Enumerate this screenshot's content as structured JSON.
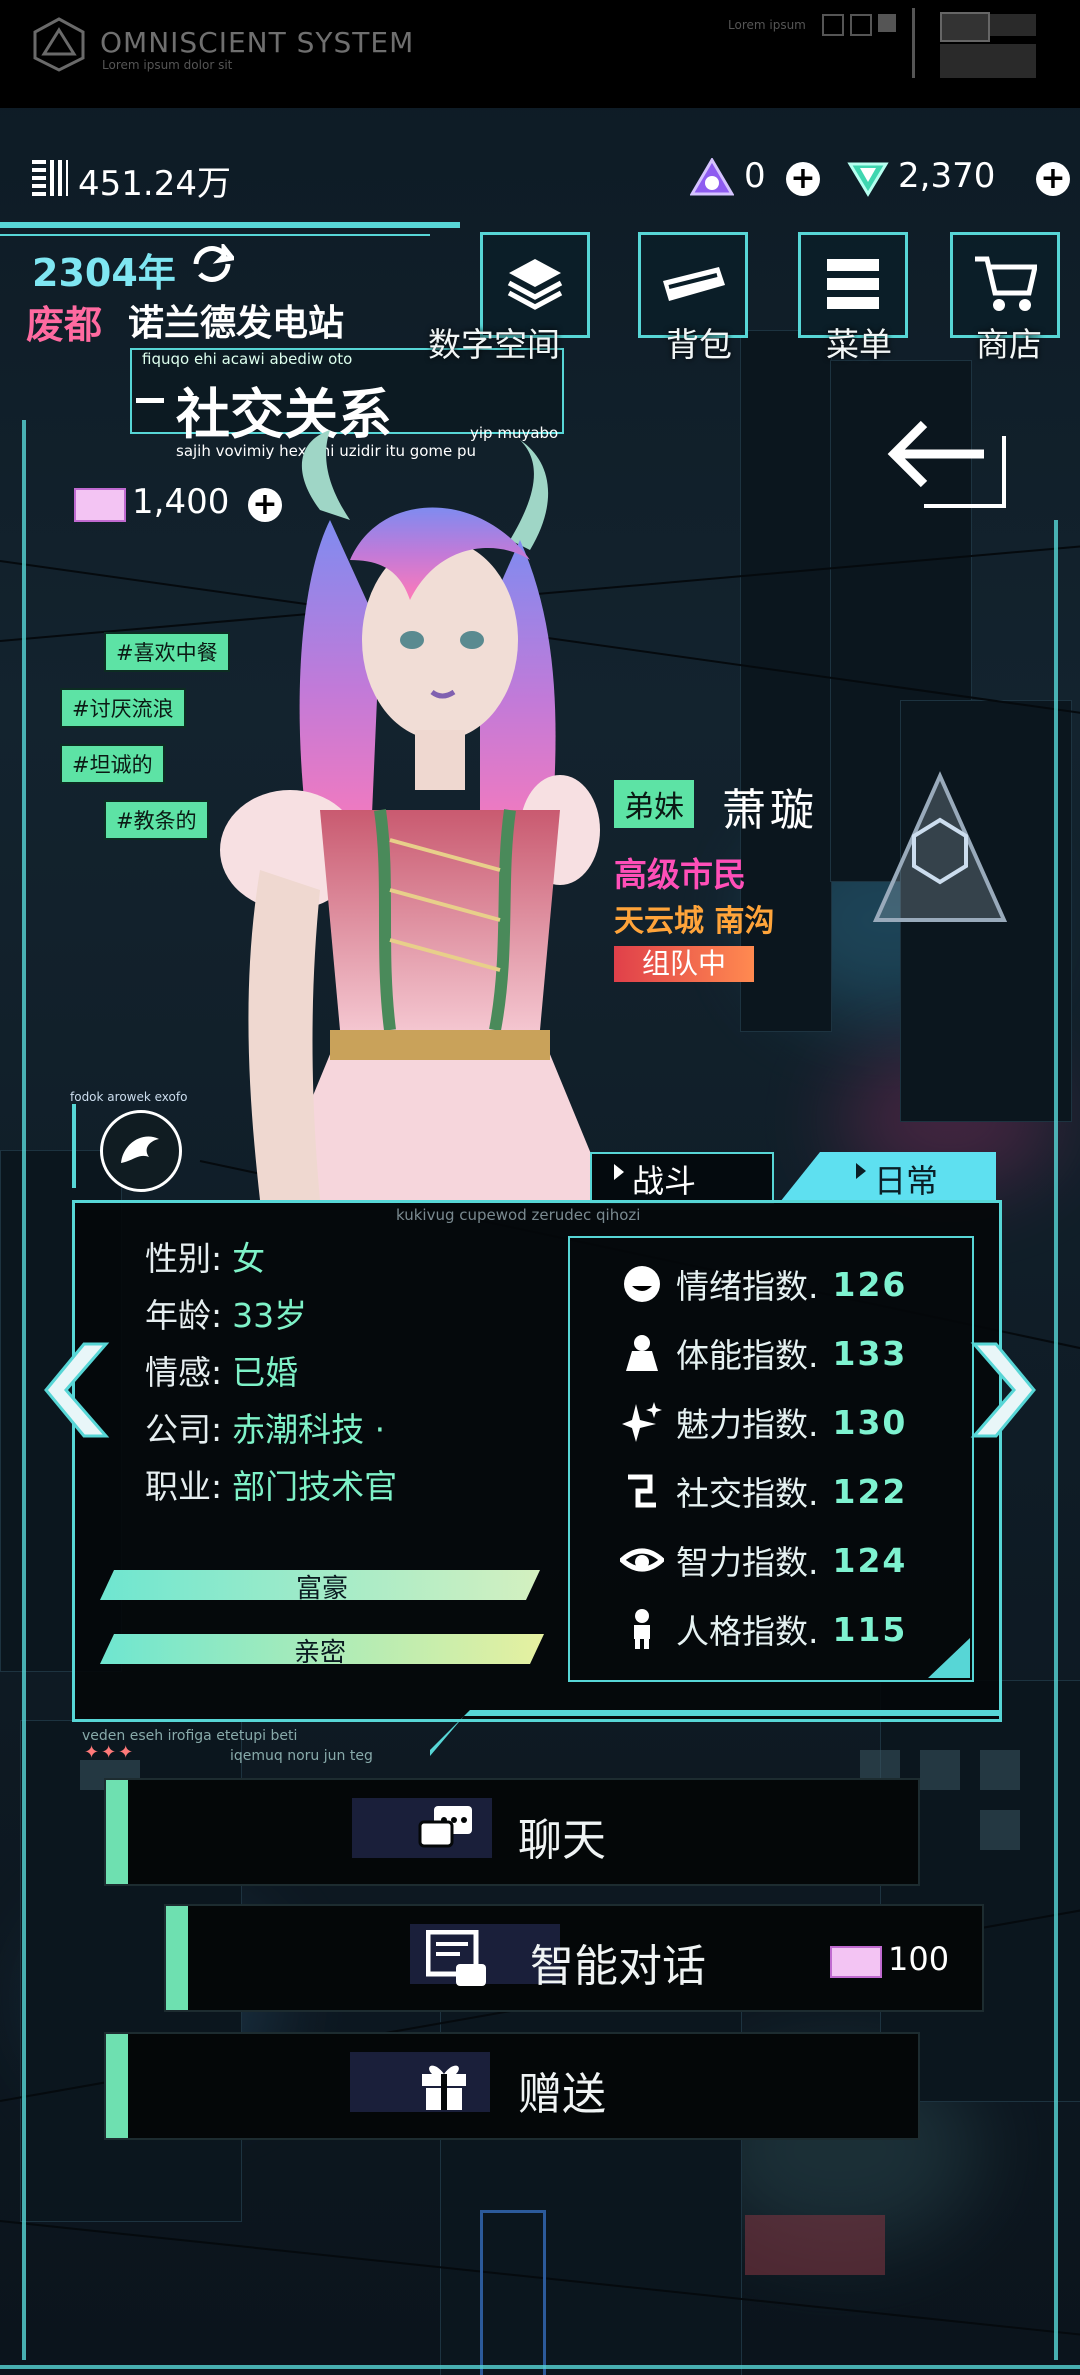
{
  "system": {
    "title": "OMNISCIENT SYSTEM",
    "subtitle": "Lorem ipsum dolor sit",
    "mini": "Lorem ipsum"
  },
  "currency": {
    "money": "451.24万",
    "gems": "0",
    "crystals": "2,370",
    "tickets": "1,400"
  },
  "location": {
    "year": "2304年",
    "city": "废都",
    "place": "诺兰德发电站"
  },
  "page": {
    "title": "社交关系",
    "caption_top": "fiquqo ehi acawi abediw oto",
    "caption_right": "yip muyabo",
    "caption_bottom": "sajih vovimiy hexami uzidir itu gome pu"
  },
  "menu": {
    "items": [
      "数字空间",
      "背包",
      "菜单",
      "商店"
    ]
  },
  "tags": [
    "#喜欢中餐",
    "#讨厌流浪",
    "#坦诚的",
    "#教条的"
  ],
  "character": {
    "relation": "弟妹",
    "name": "萧璇",
    "rank": "高级市民",
    "home": "天云城 南沟",
    "status": "组队中",
    "emblem_caption": "fodok arowek exofo"
  },
  "tabs": {
    "battle": "战斗",
    "daily": "日常"
  },
  "panel": {
    "caption_top": "kukivug cupewod zerudec qihozi",
    "caption_bottom1": "veden eseh irofiga etetupi beti",
    "caption_bottom2": "iqemuq noru jun teg",
    "info": [
      {
        "label": "性别:",
        "value": "女"
      },
      {
        "label": "年龄:",
        "value": "33岁"
      },
      {
        "label": "情感:",
        "value": "已婚"
      },
      {
        "label": "公司:",
        "value": "赤潮科技 ·"
      },
      {
        "label": "职业:",
        "value": "部门技术官"
      }
    ],
    "bars": [
      {
        "label": "富豪",
        "fill": 1.0
      },
      {
        "label": "亲密",
        "fill": 1.0
      }
    ],
    "stats": [
      {
        "label": "情绪指数.",
        "value": "126",
        "icon": "mood-icon"
      },
      {
        "label": "体能指数.",
        "value": "133",
        "icon": "fitness-icon"
      },
      {
        "label": "魅力指数.",
        "value": "130",
        "icon": "sparkle-icon"
      },
      {
        "label": "社交指数.",
        "value": "122",
        "icon": "social-icon"
      },
      {
        "label": "智力指数.",
        "value": "124",
        "icon": "eye-icon"
      },
      {
        "label": "人格指数.",
        "value": "115",
        "icon": "person-icon"
      }
    ]
  },
  "actions": {
    "chat": "聊天",
    "ai_chat": "智能对话",
    "ai_chat_cost": "100",
    "gift": "赠送"
  },
  "colors": {
    "accent": "#57d6d6",
    "green": "#5de3a5",
    "pink": "#ff4fb8",
    "orange": "#ffa43a"
  }
}
